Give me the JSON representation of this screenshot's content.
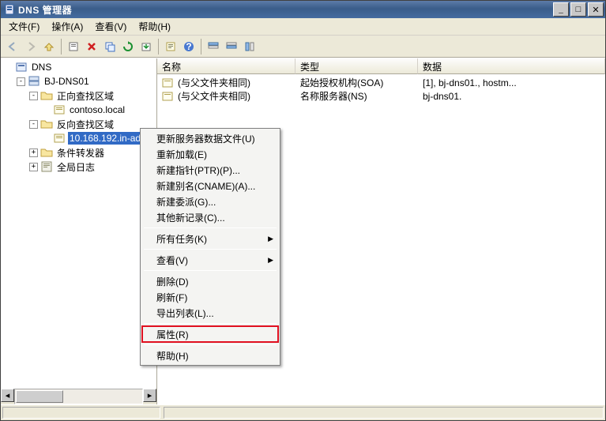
{
  "window": {
    "title": "DNS 管理器"
  },
  "menubar": [
    {
      "label": "文件(F)"
    },
    {
      "label": "操作(A)"
    },
    {
      "label": "查看(V)"
    },
    {
      "label": "帮助(H)"
    }
  ],
  "toolbar_icons": [
    "back-icon",
    "forward-icon",
    "up-icon",
    "sep",
    "cut-icon",
    "delete-icon",
    "copy-icon",
    "refresh-icon",
    "export-icon",
    "sep",
    "properties-icon",
    "help-icon",
    "sep",
    "filter-icon",
    "find-icon",
    "column-icon"
  ],
  "tree": {
    "root": {
      "label": "DNS"
    },
    "server": {
      "label": "BJ-DNS01"
    },
    "fwd_zone": {
      "label": "正向查找区域"
    },
    "fwd_domain": {
      "label": "contoso.local"
    },
    "rev_zone": {
      "label": "反向查找区域"
    },
    "rev_domain": {
      "label": "10.168.192.in-addr"
    },
    "conditional": {
      "label": "条件转发器"
    },
    "global_log": {
      "label": "全局日志"
    }
  },
  "list": {
    "columns": {
      "name": "名称",
      "type": "类型",
      "data": "数据"
    },
    "widths": {
      "name": 175,
      "type": 155,
      "data": 220
    },
    "rows": [
      {
        "name": "(与父文件夹相同)",
        "type": "起始授权机构(SOA)",
        "data": "[1], bj-dns01., hostm..."
      },
      {
        "name": "(与父文件夹相同)",
        "type": "名称服务器(NS)",
        "data": "bj-dns01."
      }
    ]
  },
  "context_menu": {
    "groups": [
      [
        {
          "label": "更新服务器数据文件(U)"
        },
        {
          "label": "重新加载(E)"
        },
        {
          "label": "新建指针(PTR)(P)..."
        },
        {
          "label": "新建别名(CNAME)(A)..."
        },
        {
          "label": "新建委派(G)..."
        },
        {
          "label": "其他新记录(C)..."
        }
      ],
      [
        {
          "label": "所有任务(K)",
          "submenu": true
        }
      ],
      [
        {
          "label": "查看(V)",
          "submenu": true
        }
      ],
      [
        {
          "label": "删除(D)"
        },
        {
          "label": "刷新(F)"
        },
        {
          "label": "导出列表(L)..."
        }
      ],
      [
        {
          "label": "属性(R)",
          "highlight": true
        }
      ],
      [
        {
          "label": "帮助(H)"
        }
      ]
    ]
  }
}
